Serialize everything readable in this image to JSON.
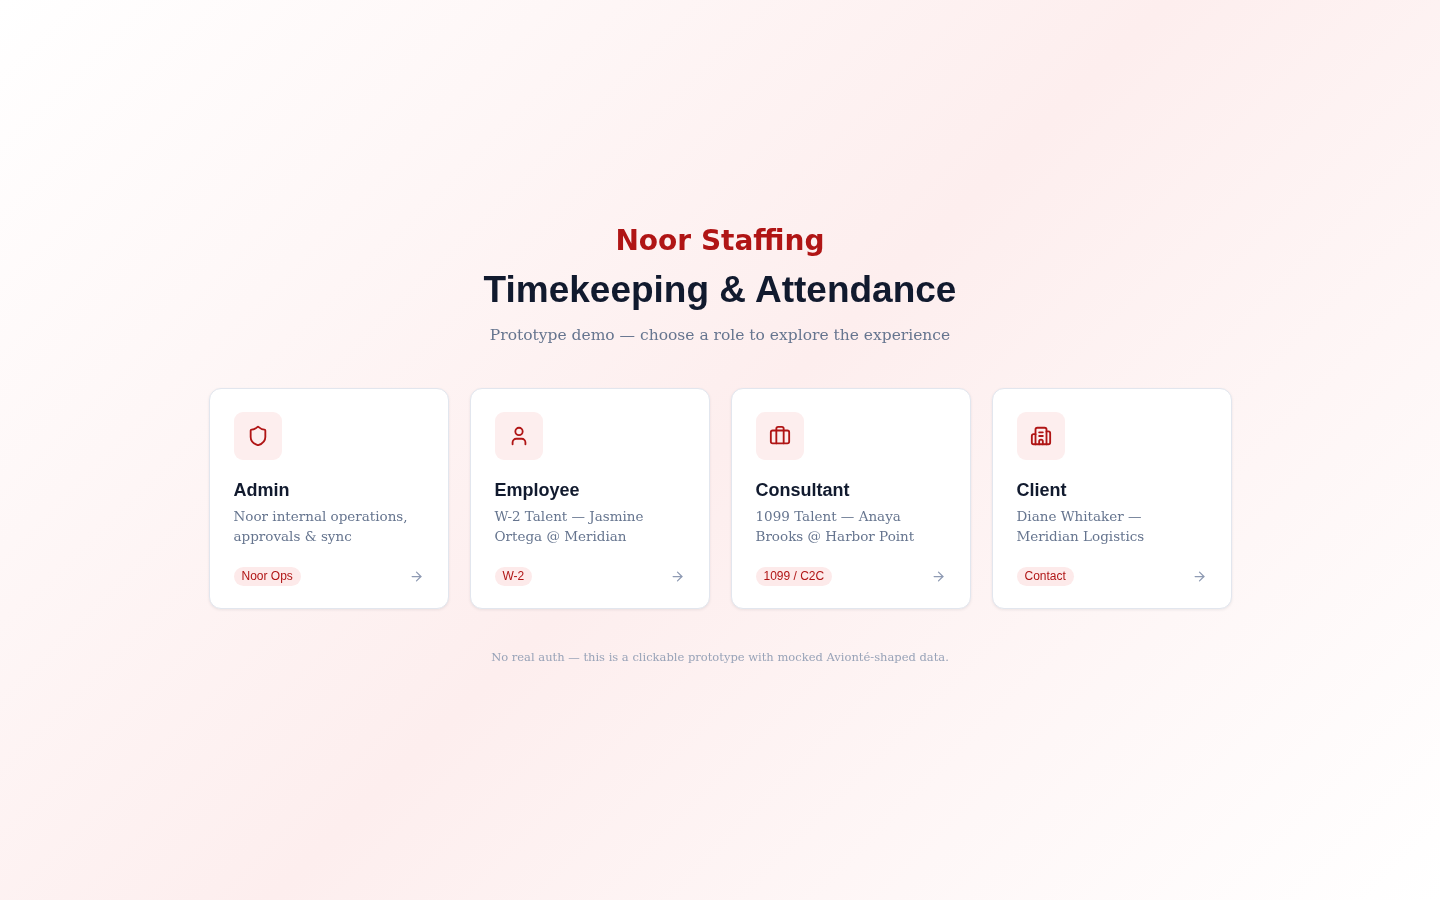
{
  "brand": "Noor Staffing",
  "title": "Timekeeping & Attendance",
  "subtitle": "Prototype demo — choose a role to explore the experience",
  "roles": [
    {
      "kind": "admin",
      "title": "Admin",
      "description": "Noor internal operations, approvals & sync",
      "badge": "Noor Ops"
    },
    {
      "kind": "employee",
      "title": "Employee",
      "description": "W-2 Talent — Jasmine Ortega @ Meridian",
      "badge": "W-2"
    },
    {
      "kind": "consultant",
      "title": "Consultant",
      "description": "1099 Talent — Anaya Brooks @ Harbor Point",
      "badge": "1099 / C2C"
    },
    {
      "kind": "client",
      "title": "Client",
      "description": "Diane Whitaker — Meridian Logistics",
      "badge": "Contact"
    }
  ],
  "footer": "No real auth — this is a clickable prototype with mocked Avionté-shaped data."
}
